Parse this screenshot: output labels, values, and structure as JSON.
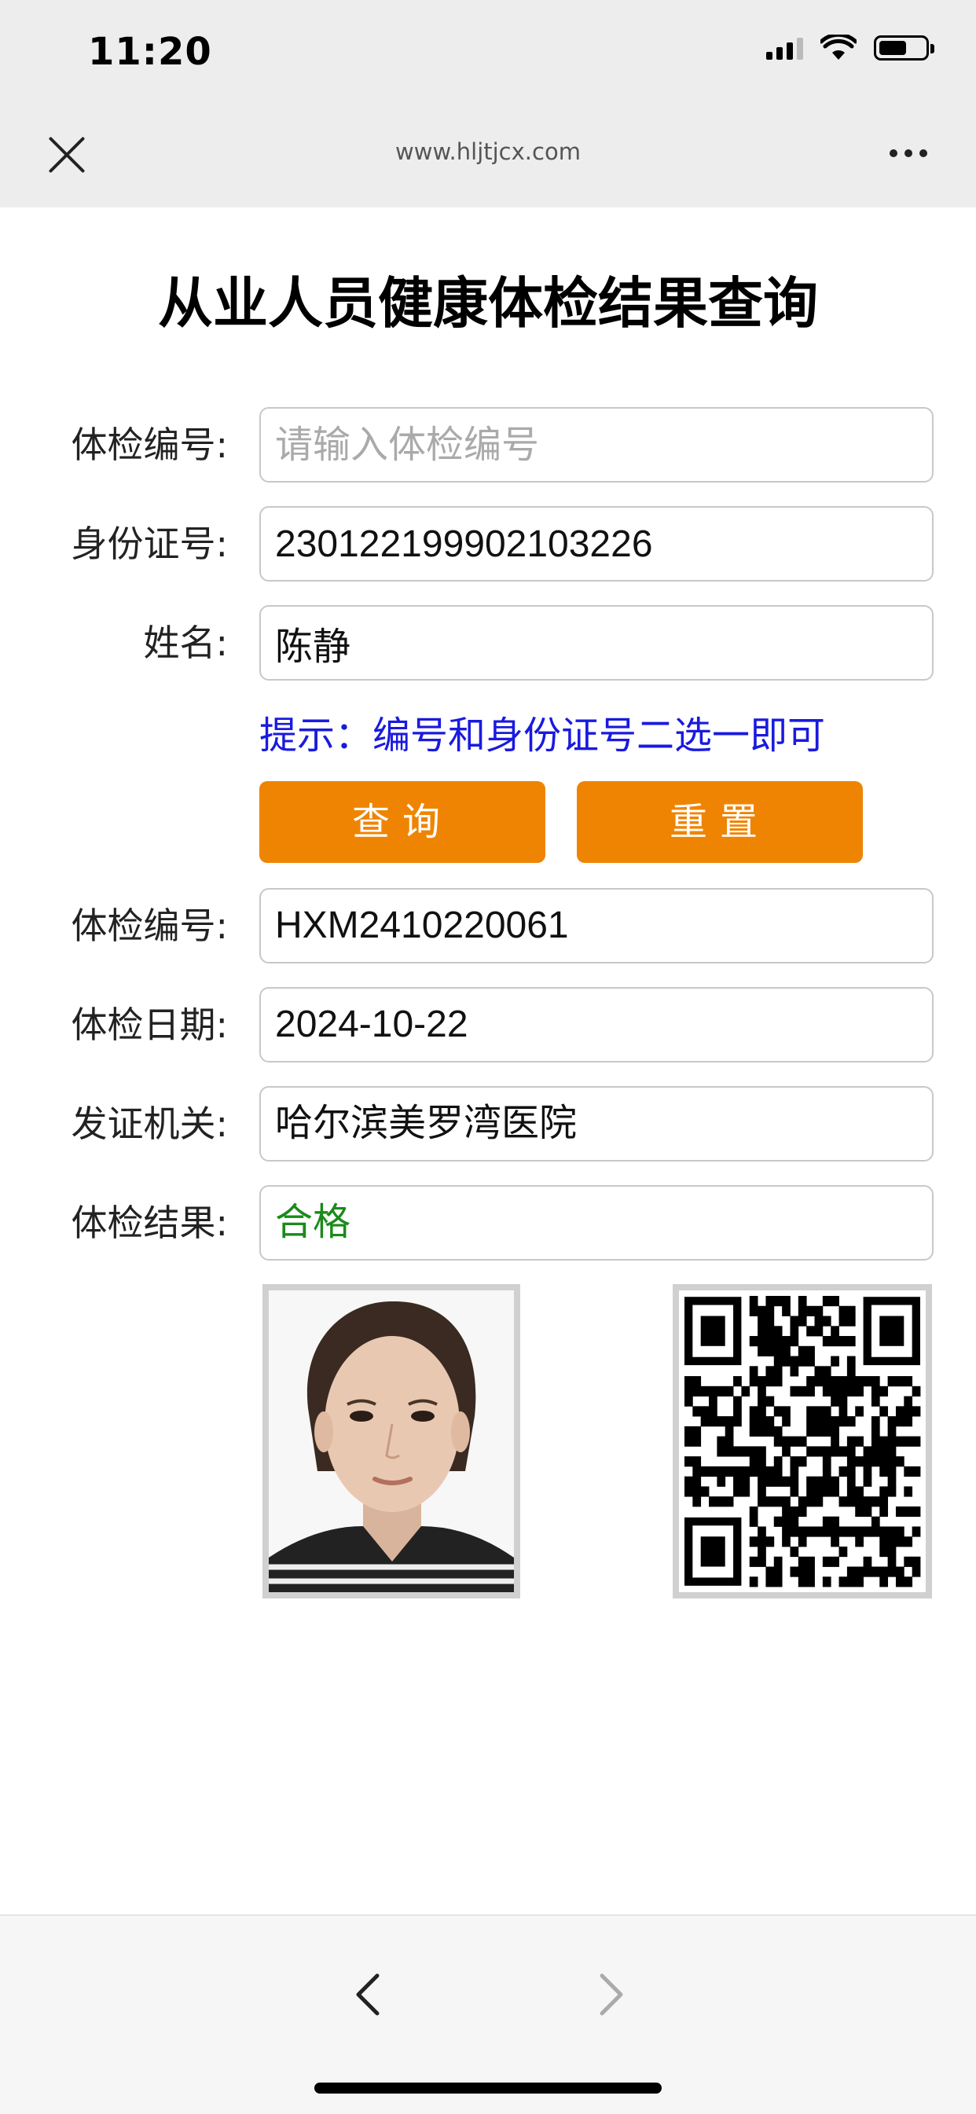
{
  "status_bar": {
    "time": "11:20"
  },
  "browser": {
    "url": "www.hljtjcx.com",
    "close_icon": "close-icon",
    "more_icon": "more-dots-icon"
  },
  "page": {
    "title": "从业人员健康体检结果查询"
  },
  "form": {
    "exam_no": {
      "label": "体检编号:",
      "placeholder": "请输入体检编号",
      "value": ""
    },
    "id_no": {
      "label": "身份证号:",
      "value": "230122199902103226"
    },
    "name": {
      "label": "姓名:",
      "value": "陈静"
    },
    "hint": "提示：编号和身份证号二选一即可",
    "query_label": "查询",
    "reset_label": "重置"
  },
  "result": {
    "exam_no": {
      "label": "体检编号:",
      "value": "HXM2410220061"
    },
    "exam_date": {
      "label": "体检日期:",
      "value": "2024-10-22"
    },
    "issuer": {
      "label": "发证机关:",
      "value": "哈尔滨美罗湾医院"
    },
    "conclusion": {
      "label": "体检结果:",
      "value": "合格"
    }
  },
  "colors": {
    "accent": "#ef8403",
    "hint": "#1a1adf",
    "pass": "#1a8a1a"
  },
  "bottom_bar": {
    "back_icon": "chevron-left-icon",
    "forward_icon": "chevron-right-icon"
  }
}
